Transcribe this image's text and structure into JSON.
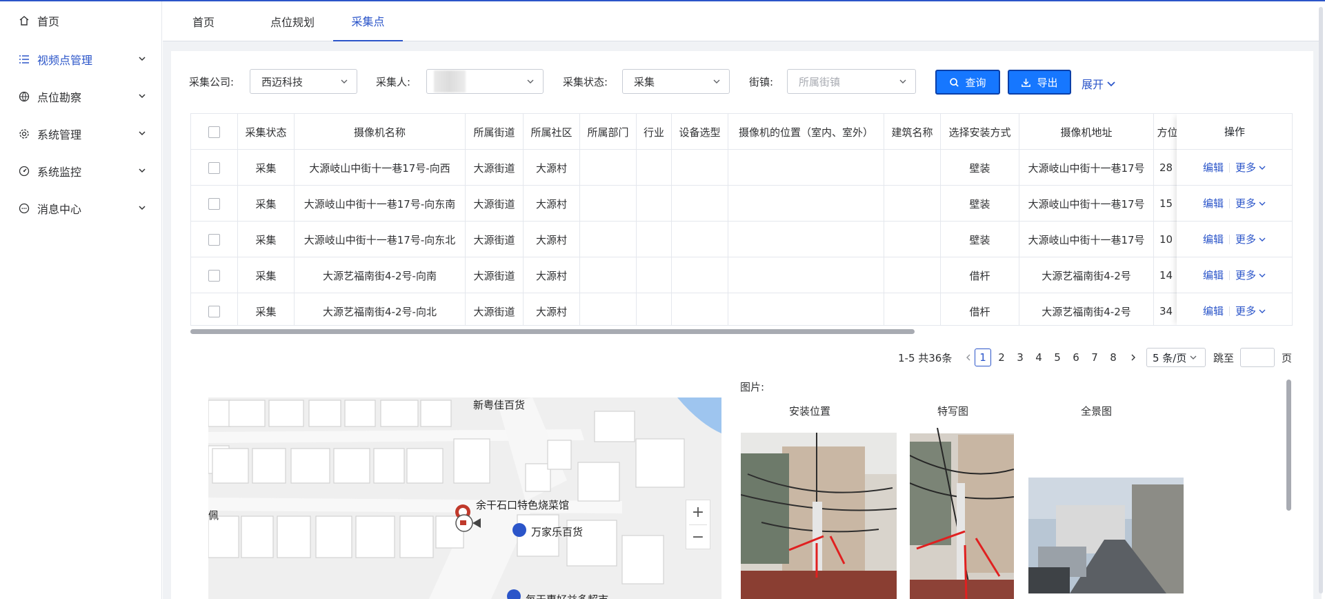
{
  "sidebar": {
    "items": [
      {
        "label": "首页",
        "icon": "home-icon"
      },
      {
        "label": "视频点管理",
        "icon": "list-icon",
        "active": true
      },
      {
        "label": "点位勘察",
        "icon": "globe-icon"
      },
      {
        "label": "系统管理",
        "icon": "gear-icon"
      },
      {
        "label": "系统监控",
        "icon": "dashboard-icon"
      },
      {
        "label": "消息中心",
        "icon": "chat-icon"
      }
    ]
  },
  "tabs": [
    {
      "label": "首页"
    },
    {
      "label": "点位规划"
    },
    {
      "label": "采集点",
      "active": true
    }
  ],
  "filters": {
    "company_label": "采集公司:",
    "company_value": "西迈科技",
    "collector_label": "采集人:",
    "collector_value": "",
    "status_label": "采集状态:",
    "status_value": "采集",
    "town_label": "街镇:",
    "town_placeholder": "所属街镇",
    "query_button": "查询",
    "export_button": "导出",
    "expand_link": "展开"
  },
  "table": {
    "headers": [
      "采集状态",
      "摄像机名称",
      "所属街道",
      "所属社区",
      "所属部门",
      "行业",
      "设备选型",
      "摄像机的位置（室内、室外）",
      "建筑名称",
      "选择安装方式",
      "摄像机地址",
      "方位"
    ],
    "op_header": "操作",
    "edit_label": "编辑",
    "more_label": "更多",
    "rows": [
      {
        "status": "采集",
        "name": "大源岐山中街十一巷17号-向西",
        "street": "大源街道",
        "community": "大源村",
        "dept": "",
        "industry": "",
        "device": "",
        "position": "",
        "building": "",
        "install": "壁装",
        "address": "大源岐山中街十一巷17号",
        "azimuth": "28"
      },
      {
        "status": "采集",
        "name": "大源岐山中街十一巷17号-向东南",
        "street": "大源街道",
        "community": "大源村",
        "dept": "",
        "industry": "",
        "device": "",
        "position": "",
        "building": "",
        "install": "壁装",
        "address": "大源岐山中街十一巷17号",
        "azimuth": "15"
      },
      {
        "status": "采集",
        "name": "大源岐山中街十一巷17号-向东北",
        "street": "大源街道",
        "community": "大源村",
        "dept": "",
        "industry": "",
        "device": "",
        "position": "",
        "building": "",
        "install": "壁装",
        "address": "大源岐山中街十一巷17号",
        "azimuth": "10"
      },
      {
        "status": "采集",
        "name": "大源艺福南街4-2号-向南",
        "street": "大源街道",
        "community": "大源村",
        "dept": "",
        "industry": "",
        "device": "",
        "position": "",
        "building": "",
        "install": "借杆",
        "address": "大源艺福南街4-2号",
        "azimuth": "14"
      },
      {
        "status": "采集",
        "name": "大源艺福南街4-2号-向北",
        "street": "大源街道",
        "community": "大源村",
        "dept": "",
        "industry": "",
        "device": "",
        "position": "",
        "building": "",
        "install": "借杆",
        "address": "大源艺福南街4-2号",
        "azimuth": "34"
      }
    ]
  },
  "pagination": {
    "summary": "1-5 共36条",
    "pages": [
      "1",
      "2",
      "3",
      "4",
      "5",
      "6",
      "7",
      "8"
    ],
    "current": "1",
    "page_size": "5 条/页",
    "jump_label": "跳至",
    "page_unit": "页"
  },
  "map": {
    "labels": [
      "新粤佳百货",
      "余干石口特色烧菜馆",
      "万家乐百货",
      "佩",
      "每天惠好益多超市"
    ],
    "zoom_in": "+",
    "zoom_out": "−"
  },
  "photos": {
    "title": "图片:",
    "captions": [
      "安装位置",
      "特写图",
      "全景图"
    ]
  },
  "colors": {
    "accent": "#2b55c9",
    "button": "#1677ff"
  }
}
